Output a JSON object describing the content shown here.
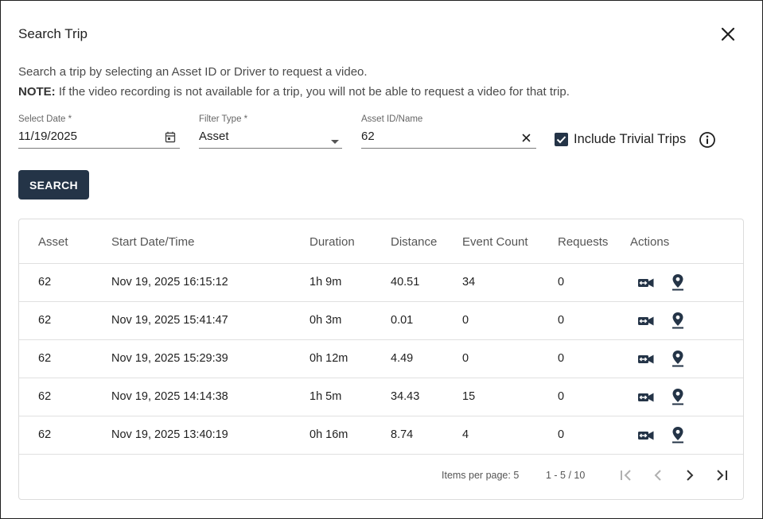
{
  "dialog": {
    "title": "Search Trip",
    "description_line1": "Search a trip by selecting an Asset ID or Driver to request a video.",
    "note_label": "NOTE:",
    "note_text": " If the video recording is not available for a trip, you will not be able to request a video for that trip."
  },
  "form": {
    "date_label": "Select Date *",
    "date_value": "11/19/2025",
    "filter_label": "Filter Type *",
    "filter_value": "Asset",
    "asset_label": "Asset ID/Name",
    "asset_value": "62",
    "include_trivial_label": "Include Trivial Trips",
    "include_trivial_checked": true,
    "search_label": "SEARCH"
  },
  "table": {
    "headers": [
      "Asset",
      "Start Date/Time",
      "Duration",
      "Distance",
      "Event Count",
      "Requests",
      "Actions"
    ],
    "rows": [
      [
        "62",
        "Nov 19, 2025 16:15:12",
        "1h 9m",
        "40.51",
        "34",
        "0"
      ],
      [
        "62",
        "Nov 19, 2025 15:41:47",
        "0h 3m",
        "0.01",
        "0",
        "0"
      ],
      [
        "62",
        "Nov 19, 2025 15:29:39",
        "0h 12m",
        "4.49",
        "0",
        "0"
      ],
      [
        "62",
        "Nov 19, 2025 14:14:38",
        "1h 5m",
        "34.43",
        "15",
        "0"
      ],
      [
        "62",
        "Nov 19, 2025 13:40:19",
        "0h 16m",
        "8.74",
        "4",
        "0"
      ]
    ],
    "action_icons": [
      "video-request-icon",
      "map-pin-icon"
    ]
  },
  "pagination": {
    "items_per_page": "Items per page: 5",
    "range": "1 - 5 / 10"
  },
  "colors": {
    "primary": "#243447",
    "border": "#dcdcdc",
    "row_divider": "#e0e0e0",
    "muted_text": "#555555"
  }
}
